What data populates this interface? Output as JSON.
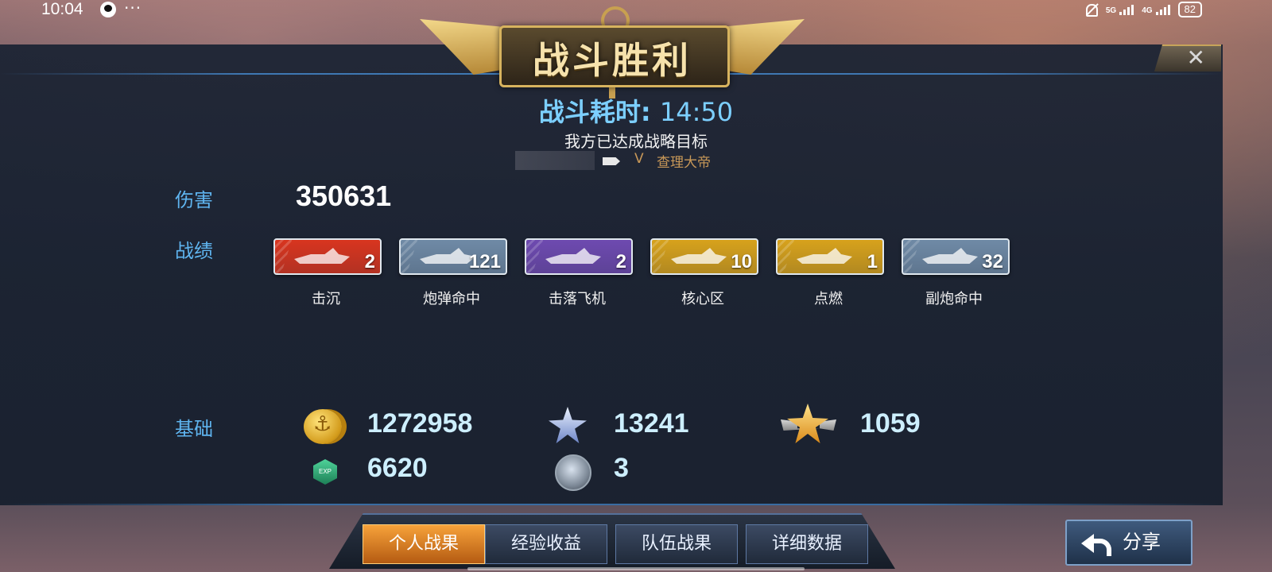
{
  "status_bar": {
    "time": "10:04",
    "more": "···",
    "net1": "5G",
    "net2": "4G",
    "battery": "82",
    "icons": [
      "qq-icon",
      "mute-bell-icon",
      "signal-icon",
      "battery-icon"
    ]
  },
  "banner": {
    "title": "战斗胜利"
  },
  "close": {
    "label": "✕"
  },
  "battle": {
    "duration_label": "战斗耗时:",
    "duration_value": "14:50",
    "objective": "我方已达成战略目标",
    "player_rank": "V",
    "player_name": "查理大帝"
  },
  "damage": {
    "label": "伤害",
    "value": "350631"
  },
  "records": {
    "label": "战绩",
    "items": [
      {
        "label": "击沉",
        "count": "2",
        "color": "#d8351f",
        "icon": "sunk-ship-icon"
      },
      {
        "label": "炮弹命中",
        "count": "121",
        "color": "#6f8aa6",
        "icon": "shell-hit-icon"
      },
      {
        "label": "击落飞机",
        "count": "2",
        "color": "#6e4ab0",
        "icon": "plane-down-icon"
      },
      {
        "label": "核心区",
        "count": "10",
        "color": "#d7a21c",
        "icon": "core-zone-icon"
      },
      {
        "label": "点燃",
        "count": "1",
        "color": "#d7a21c",
        "icon": "ignite-icon"
      },
      {
        "label": "副炮命中",
        "count": "32",
        "color": "#6f8aa6",
        "icon": "secondary-gun-icon"
      }
    ]
  },
  "base": {
    "label": "基础",
    "gold": "1272958",
    "blue_star": "13241",
    "gold_star": "1059",
    "exp": "6620",
    "exp_icon_text": "EXP",
    "token": "3"
  },
  "tabs": [
    {
      "label": "个人战果",
      "active": true
    },
    {
      "label": "经验收益",
      "active": false
    },
    {
      "label": "队伍战果",
      "active": false
    },
    {
      "label": "详细数据",
      "active": false
    }
  ],
  "share": {
    "label": "分享"
  }
}
